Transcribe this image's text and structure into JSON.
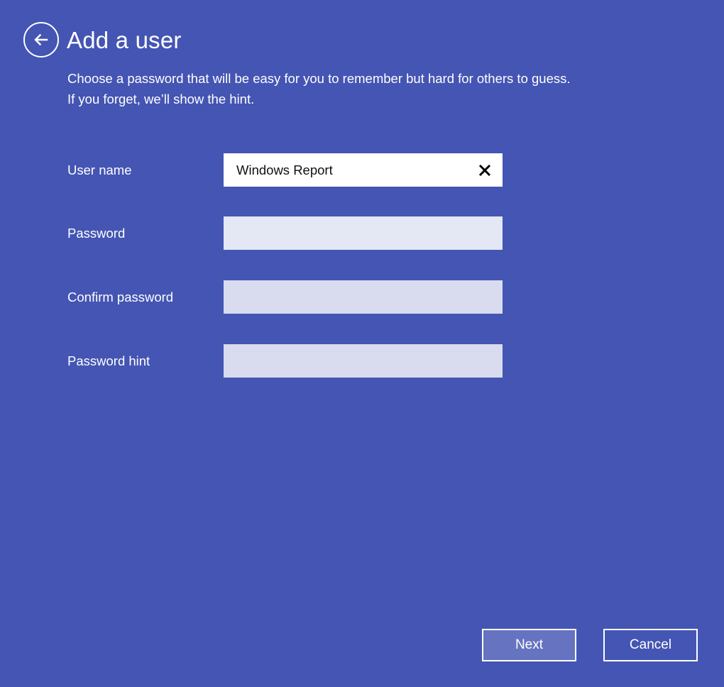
{
  "window": {
    "background_color": "#4455b3",
    "title": "Add a user"
  },
  "header": {
    "back_icon": "back-arrow-circle-icon",
    "title": "Add a user",
    "subtitle_line_1": "Choose a password that will be easy for you to remember but hard for others to guess.",
    "subtitle_line_2": "If you forget, we’ll show the hint."
  },
  "form": {
    "fields": [
      {
        "label": "User name",
        "value": "Windows Report",
        "placeholder": "",
        "type": "text",
        "state": "filled",
        "has_clear_button": true,
        "clear_icon": "close-x-icon",
        "background_color": "#ffffff"
      },
      {
        "label": "Password",
        "value": "",
        "placeholder": "",
        "type": "password",
        "state": "empty",
        "has_clear_button": false,
        "background_color": "#e4e7f4"
      },
      {
        "label": "Confirm password",
        "value": "",
        "placeholder": "",
        "type": "password",
        "state": "empty",
        "has_clear_button": false,
        "background_color": "#d8dcee"
      },
      {
        "label": "Password hint",
        "value": "",
        "placeholder": "",
        "type": "text",
        "state": "empty",
        "has_clear_button": false,
        "background_color": "#d8dcee"
      }
    ]
  },
  "footer": {
    "next_label": "Next",
    "cancel_label": "Cancel",
    "next_fill_color": "#6673c0",
    "border_color": "#ffffff"
  }
}
